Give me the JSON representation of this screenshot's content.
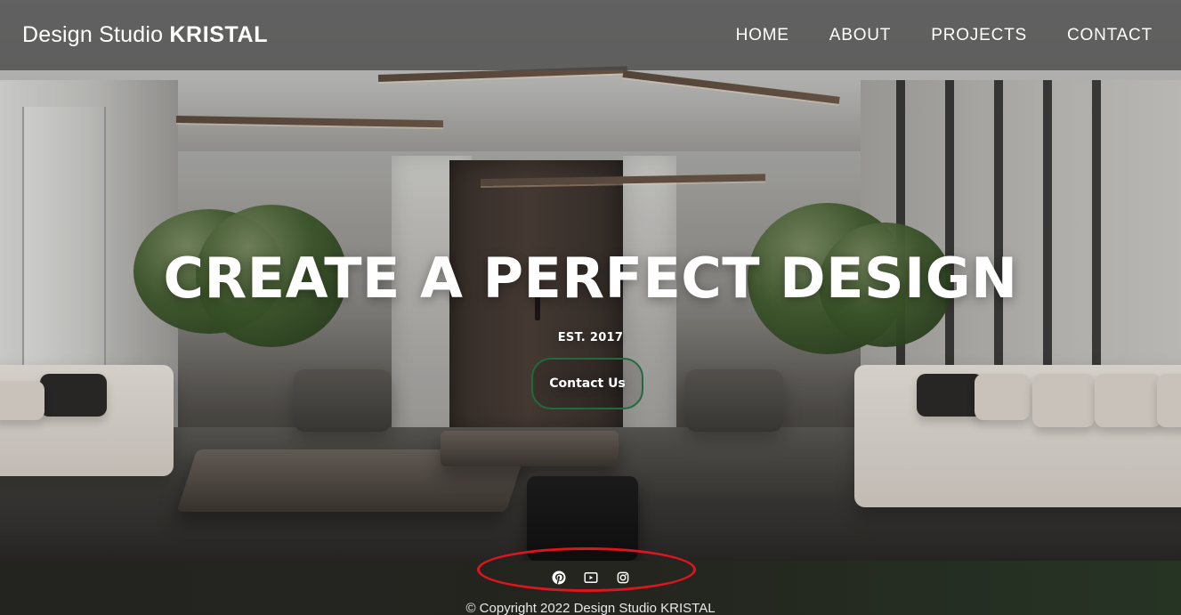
{
  "header": {
    "brand_prefix": "Design Studio ",
    "brand_name": "KRISTAL",
    "nav": [
      "HOME",
      "ABOUT",
      "PROJECTS",
      "CONTACT"
    ]
  },
  "hero": {
    "title": "CREATE A PERFECT DESIGN",
    "subtitle": "EST. 2017",
    "cta_label": "Contact Us"
  },
  "footer": {
    "social_icons": [
      "pinterest-icon",
      "youtube-icon",
      "instagram-icon"
    ],
    "copyright": "© Copyright 2022 Design Studio KRISTAL"
  },
  "colors": {
    "cta_border": "#1f6b3e",
    "annotation_red": "#e0141d"
  }
}
